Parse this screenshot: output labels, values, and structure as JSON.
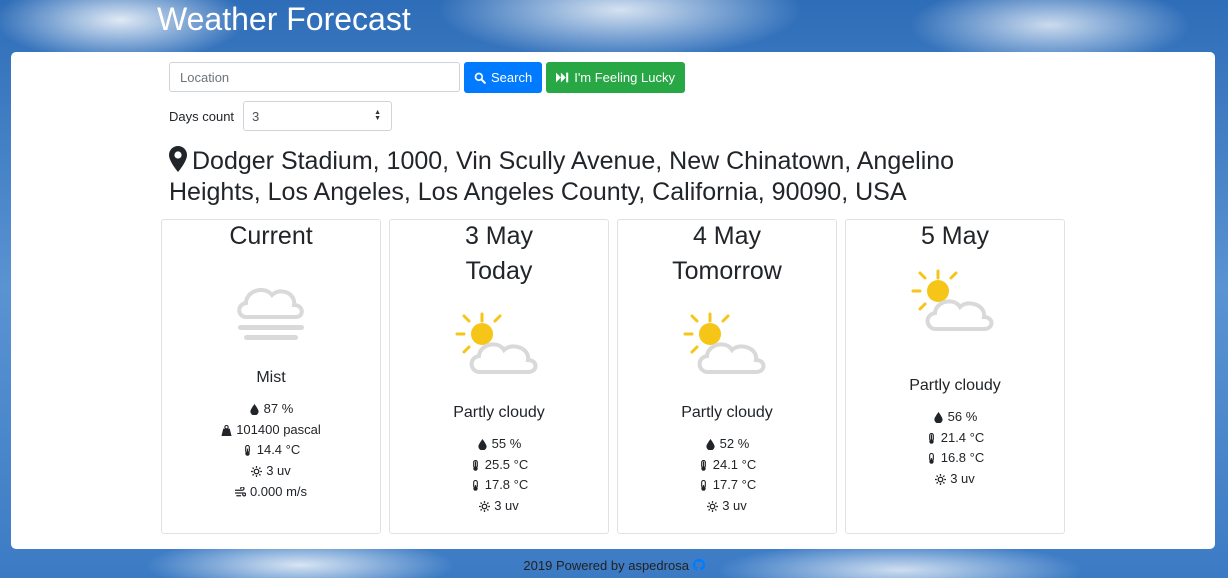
{
  "app": {
    "title": "Weather Forecast"
  },
  "search": {
    "placeholder": "Location",
    "value": "",
    "search_label": "Search",
    "lucky_label": "I'm Feeling Lucky"
  },
  "days": {
    "label": "Days count",
    "selected": "3"
  },
  "location": "Dodger Stadium, 1000, Vin Scully Avenue, New Chinatown, Angelino Heights, Los Angeles, Los Angeles County, California, 90090, USA",
  "cards": [
    {
      "title": "Current",
      "subtitle": "",
      "icon": "mist-cloud-icon",
      "condition": "Mist",
      "humidity": "87 %",
      "pressure": "101400 pascal",
      "temp": "14.4 °C",
      "uv": "3 uv",
      "wind": "0.000 m/s"
    },
    {
      "title": "3 May",
      "subtitle": "Today",
      "icon": "partly-cloudy-icon",
      "condition": "Partly cloudy",
      "humidity": "55 %",
      "temp_max": "25.5 °C",
      "temp_min": "17.8 °C",
      "uv": "3 uv"
    },
    {
      "title": "4 May",
      "subtitle": "Tomorrow",
      "icon": "partly-cloudy-icon",
      "condition": "Partly cloudy",
      "humidity": "52 %",
      "temp_max": "24.1 °C",
      "temp_min": "17.7 °C",
      "uv": "3 uv"
    },
    {
      "title": "5 May",
      "subtitle": "",
      "icon": "partly-cloudy-icon",
      "condition": "Partly cloudy",
      "humidity": "56 %",
      "temp_max": "21.4 °C",
      "temp_min": "16.8 °C",
      "uv": "3 uv"
    }
  ],
  "footer": {
    "text": "2019 Powered by aspedrosa",
    "icon": "github-icon"
  },
  "colors": {
    "primary": "#007bff",
    "success": "#28a745",
    "sun": "#f5c518",
    "cloud": "#d9d9d9"
  }
}
